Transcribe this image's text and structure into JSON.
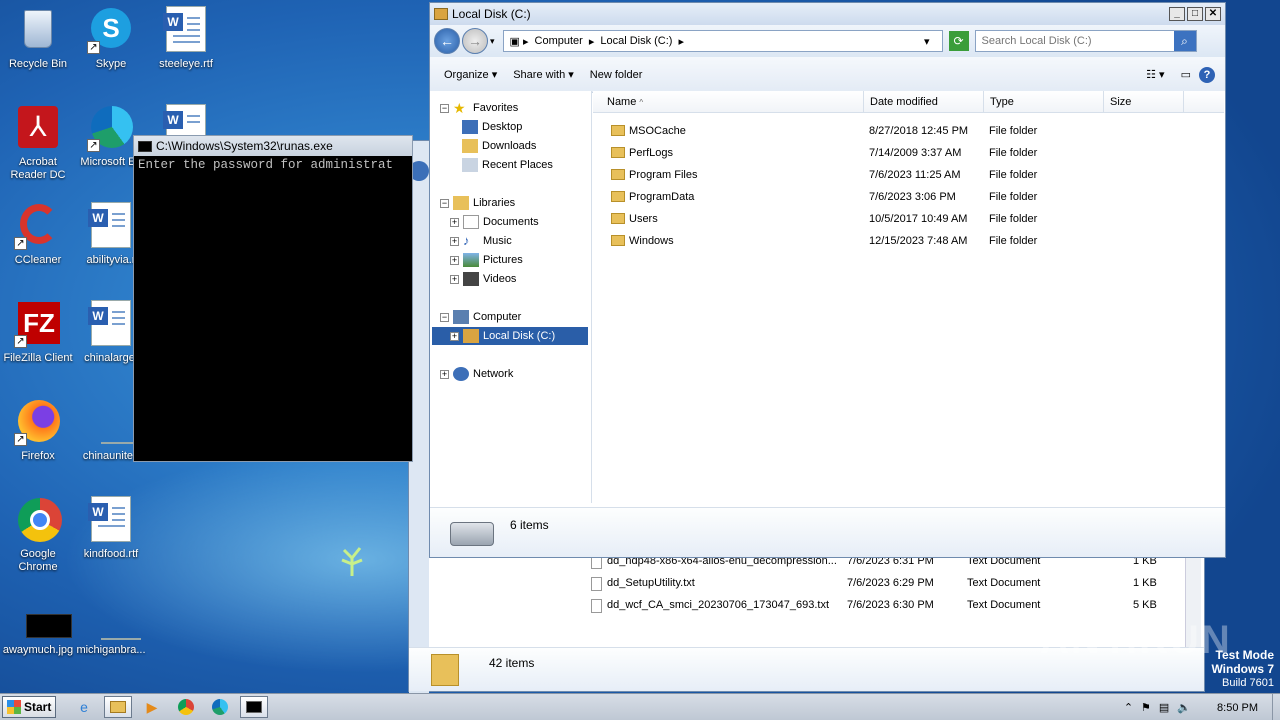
{
  "desktop": {
    "icons": [
      {
        "label": "Recycle Bin"
      },
      {
        "label": "Skype"
      },
      {
        "label": "steeleye.rtf"
      },
      {
        "label": "Acrobat Reader DC"
      },
      {
        "label": "Microsoft Ed"
      },
      {
        "label": "CCleaner"
      },
      {
        "label": "abilityvia.r"
      },
      {
        "label": "FileZilla Client"
      },
      {
        "label": "chinalarge."
      },
      {
        "label": "Firefox"
      },
      {
        "label": "chinaunited"
      },
      {
        "label": "Google Chrome"
      },
      {
        "label": "kindfood.rtf"
      },
      {
        "label": "awaymuch.jpg"
      },
      {
        "label": "michiganbra..."
      }
    ]
  },
  "console": {
    "title": "C:\\Windows\\System32\\runas.exe",
    "text": "Enter the password for administrat"
  },
  "explorer": {
    "title": "Local Disk (C:)",
    "breadcrumb": [
      "Computer",
      "Local Disk (C:)"
    ],
    "search_placeholder": "Search Local Disk (C:)",
    "commands": {
      "organize": "Organize",
      "share": "Share with",
      "new_folder": "New folder"
    },
    "nav": {
      "favorites": "Favorites",
      "desktop": "Desktop",
      "downloads": "Downloads",
      "recent": "Recent Places",
      "libraries": "Libraries",
      "documents": "Documents",
      "music": "Music",
      "pictures": "Pictures",
      "videos": "Videos",
      "computer": "Computer",
      "localdisk": "Local Disk (C:)",
      "network": "Network"
    },
    "columns": {
      "name": "Name",
      "date": "Date modified",
      "type": "Type",
      "size": "Size"
    },
    "files": [
      {
        "name": "MSOCache",
        "date": "8/27/2018 12:45 PM",
        "type": "File folder"
      },
      {
        "name": "PerfLogs",
        "date": "7/14/2009 3:37 AM",
        "type": "File folder"
      },
      {
        "name": "Program Files",
        "date": "7/6/2023 11:25 AM",
        "type": "File folder"
      },
      {
        "name": "ProgramData",
        "date": "7/6/2023 3:06 PM",
        "type": "File folder"
      },
      {
        "name": "Users",
        "date": "10/5/2017 10:49 AM",
        "type": "File folder"
      },
      {
        "name": "Windows",
        "date": "12/15/2023 7:48 AM",
        "type": "File folder"
      }
    ],
    "item_count": "6 items"
  },
  "bg_explorer": {
    "files": [
      {
        "name": "dd_ndp48-x86-x64-allos-enu_decompression...",
        "date": "7/6/2023 6:31 PM",
        "type": "Text Document",
        "size": "1 KB"
      },
      {
        "name": "dd_SetupUtility.txt",
        "date": "7/6/2023 6:29 PM",
        "type": "Text Document",
        "size": "1 KB"
      },
      {
        "name": "dd_wcf_CA_smci_20230706_173047_693.txt",
        "date": "7/6/2023 6:30 PM",
        "type": "Text Document",
        "size": "5 KB"
      }
    ],
    "item_count": "42 items"
  },
  "taskbar": {
    "start_label": "Start",
    "clock": "8:50 PM"
  },
  "watermark": "ANY.RUN",
  "testmode": {
    "line1": "Test Mode",
    "line2": "Windows 7",
    "line3": "Build 7601"
  }
}
